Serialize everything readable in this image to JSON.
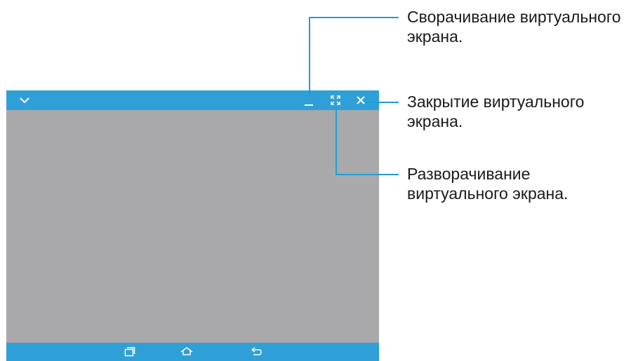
{
  "callouts": {
    "minimize": {
      "line1": "Сворачивание виртуального",
      "line2": "экрана."
    },
    "close": {
      "line1": "Закрытие виртуального",
      "line2": "экрана."
    },
    "maximize": {
      "line1": "Разворачивание",
      "line2": "виртуального экрана."
    }
  },
  "colors": {
    "accent": "#2f9fd8",
    "callout_line": "#1c9fd8",
    "screen_body": "#a9a9ac",
    "icon": "#ffffff"
  },
  "icons": {
    "top_bar": [
      "chevron-down-icon",
      "minimize-icon",
      "maximize-icon",
      "close-icon"
    ],
    "bottom_bar": [
      "recent-apps-icon",
      "home-icon",
      "back-icon"
    ]
  }
}
